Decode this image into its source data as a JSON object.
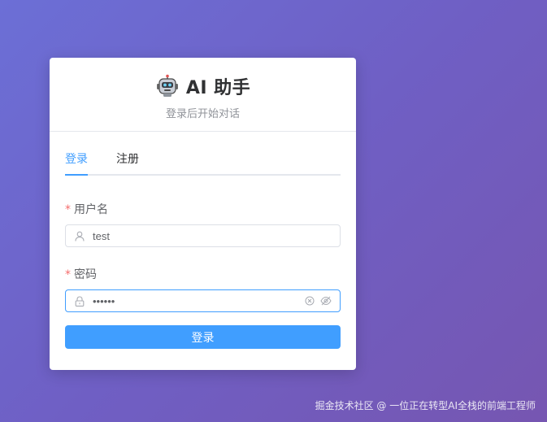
{
  "header": {
    "title": "AI 助手",
    "subtitle": "登录后开始对话",
    "logo_icon": "robot-icon"
  },
  "tabs": [
    {
      "label": "登录",
      "active": true
    },
    {
      "label": "注册",
      "active": false
    }
  ],
  "form": {
    "username": {
      "label": "用户名",
      "required_mark": "*",
      "value": "test",
      "prefix_icon": "user-icon"
    },
    "password": {
      "label": "密码",
      "required_mark": "*",
      "value": "123456",
      "prefix_icon": "lock-icon",
      "suffix_icons": [
        "clear-icon",
        "eye-hidden-icon"
      ]
    },
    "submit_label": "登录"
  },
  "watermark": "掘金技术社区 @ 一位正在转型AI全栈的前端工程师",
  "colors": {
    "accent": "#409eff",
    "required": "#f56c6c",
    "background_start": "#6c6fd6",
    "background_end": "#7656b1"
  }
}
